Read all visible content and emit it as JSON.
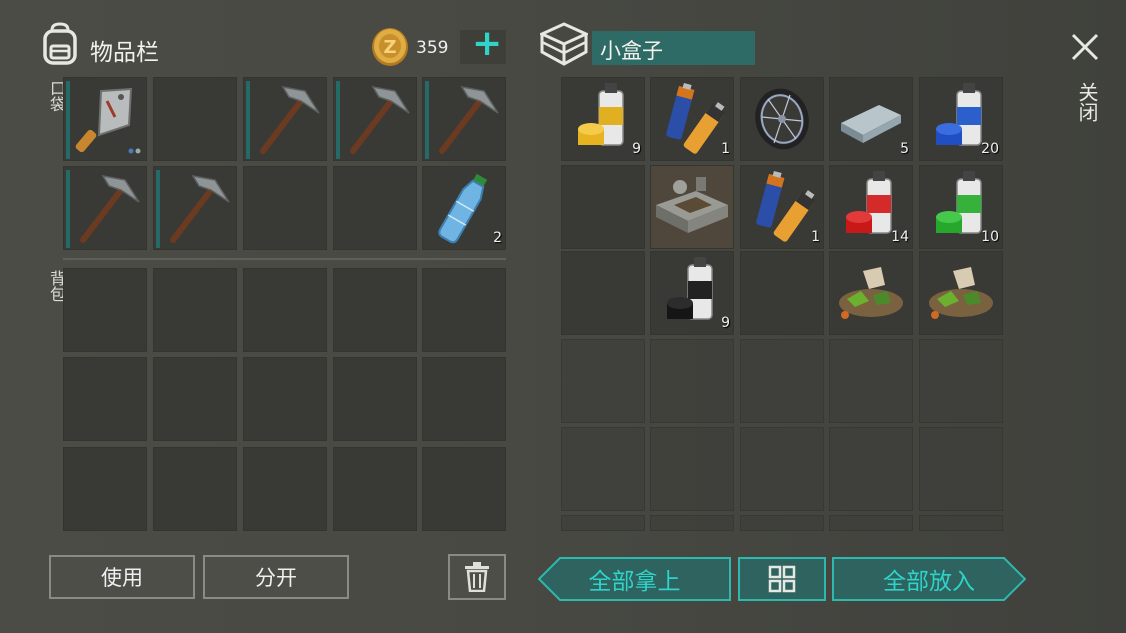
{
  "inventory": {
    "title": "物品栏",
    "currency_amount": "359",
    "add_currency_label": "+",
    "pocket_label": "口袋",
    "backpack_label": "背包",
    "pocket_slots": [
      {
        "item": "cleaver-icon",
        "count": ""
      },
      {
        "item": "",
        "count": ""
      },
      {
        "item": "pickaxe-icon",
        "count": ""
      },
      {
        "item": "pickaxe-icon",
        "count": ""
      },
      {
        "item": "pickaxe-icon",
        "count": ""
      },
      {
        "item": "pickaxe-icon",
        "count": ""
      },
      {
        "item": "pickaxe-icon",
        "count": ""
      },
      {
        "item": "",
        "count": ""
      },
      {
        "item": "",
        "count": ""
      },
      {
        "item": "water-bottle-icon",
        "count": "2"
      }
    ],
    "use_button": "使用",
    "split_button": "分开"
  },
  "container": {
    "title": "小盒子",
    "slots": [
      {
        "item": "yellow-spray-paint-icon",
        "count": "9"
      },
      {
        "item": "batteries-icon",
        "count": "1"
      },
      {
        "item": "wheel-icon",
        "count": ""
      },
      {
        "item": "metal-ingot-icon",
        "count": "5"
      },
      {
        "item": "blue-spray-paint-icon",
        "count": "20"
      },
      {
        "item": "",
        "count": ""
      },
      {
        "item": "workbench-part-icon",
        "count": ""
      },
      {
        "item": "batteries-icon",
        "count": "1"
      },
      {
        "item": "red-spray-paint-icon",
        "count": "14"
      },
      {
        "item": "green-spray-paint-icon",
        "count": "10"
      },
      {
        "item": "",
        "count": ""
      },
      {
        "item": "black-spray-paint-icon",
        "count": "9"
      },
      {
        "item": "",
        "count": ""
      },
      {
        "item": "scrap-pile-icon",
        "count": ""
      },
      {
        "item": "scrap-pile-icon",
        "count": ""
      }
    ],
    "take_all_button": "全部拿上",
    "put_all_button": "全部放入"
  },
  "close_label": "关闭",
  "colors": {
    "accent_teal": "#2fd3c8",
    "gold": "#d9a53a",
    "durability": "#256a66"
  }
}
